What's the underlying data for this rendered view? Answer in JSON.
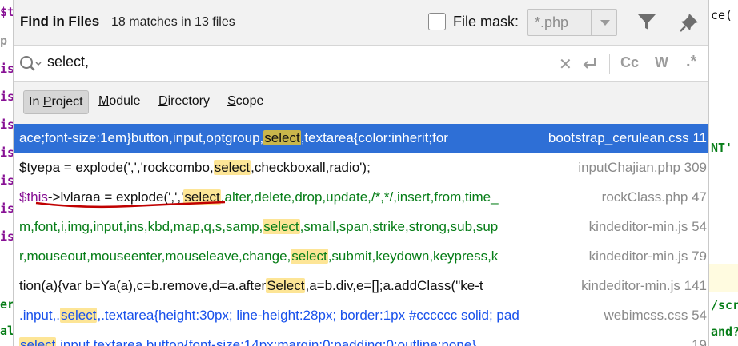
{
  "editor": {
    "left_chars": [
      "$t",
      "p",
      "is",
      "is",
      "is",
      "is",
      "is",
      "is",
      "is",
      "er",
      "al"
    ],
    "right_chars": [
      "ce(",
      "NT'",
      "/scr",
      "and?"
    ]
  },
  "header": {
    "title": "Find in Files",
    "matches": "18 matches in 13 files",
    "file_mask_label": "File mask:",
    "file_mask_value": "*.php"
  },
  "search": {
    "query": "select,",
    "match_case": "Cc",
    "words": "W",
    "regex": ".*"
  },
  "scope_tabs": [
    {
      "label": "In Project",
      "underline": "P",
      "active": true
    },
    {
      "label": "Module",
      "underline": "M",
      "active": false
    },
    {
      "label": "Directory",
      "underline": "D",
      "active": false
    },
    {
      "label": "Scope",
      "underline": "S",
      "active": false
    }
  ],
  "results": [
    {
      "pre": "ace;font-size:1em}button,input,optgroup,",
      "match": "select",
      "post": ",textarea{color:inherit;for",
      "file": "bootstrap_cerulean.css 11",
      "selected": true
    },
    {
      "pre": "$tyepa = explode(',','rockcombo,",
      "match": "select",
      "post": ",checkboxall,radio');",
      "file": "inputChajian.php 309"
    },
    {
      "pre": "$this->lvlaraa  = explode(',','",
      "match": "select",
      "post": ",alter,delete,drop,update,/*,*/,insert,from,time_",
      "file": "rockClass.php 47"
    },
    {
      "pre": "m,font,i,img,input,ins,kbd,map,q,s,samp,",
      "match": "select",
      "post": ",small,span,strike,strong,sub,sup",
      "file": "kindeditor-min.js 54"
    },
    {
      "pre": "r,mouseout,mouseenter,mouseleave,change,",
      "match": "select",
      "post": ",submit,keydown,keypress,k",
      "file": "kindeditor-min.js 79"
    },
    {
      "pre": "tion(a){var b=Ya(a),c=b.remove,d=a.after",
      "match": "Select",
      "post": ",a=b.div,e=[];a.addClass(\"ke-t",
      "file": "kindeditor-min.js 141"
    },
    {
      "pre": ".input,.",
      "match": "select",
      "post": ",.textarea{height:30px; line-height:28px; border:1px #cccccc solid; pad",
      "file": "webimcss.css 54"
    },
    {
      "pre": "",
      "match": "select",
      "post": ",input,textarea,button{font-size:14px;margin:0;padding:0;outline:none}",
      "file": "19"
    }
  ]
}
